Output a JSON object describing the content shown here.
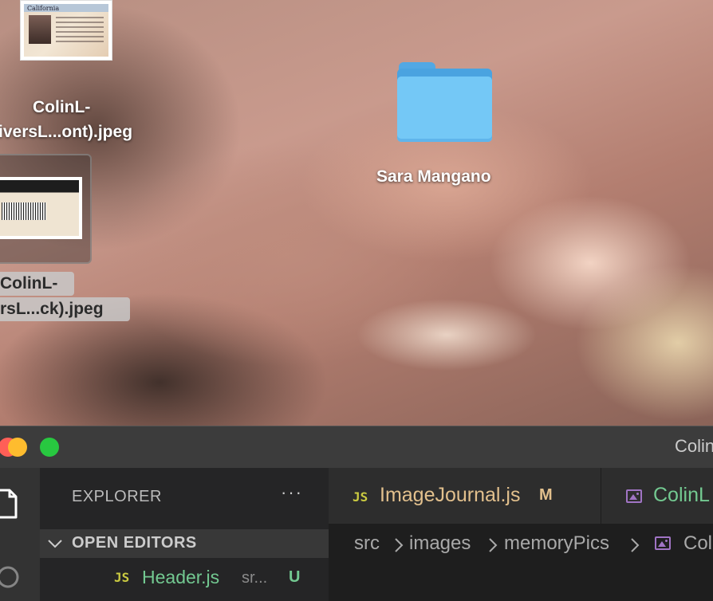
{
  "desktop": {
    "items": [
      {
        "label": "ColinL-\niversL...ont).jpeg",
        "line1": "ColinL-",
        "line2": "iversL...ont).jpeg"
      },
      {
        "label": "ColinL-\nrsL...ck).jpeg",
        "line1": "ColinL-",
        "line2": "rsL...ck).jpeg",
        "selected": true
      },
      {
        "label": "Sara Mangano"
      }
    ],
    "card_front_title": "California"
  },
  "window": {
    "title": "Colin",
    "traffic": {
      "close": "#ff5f57",
      "minimize": "#febc2e",
      "zoom": "#28c840"
    }
  },
  "sidebar": {
    "header": "EXPLORER",
    "more": "···",
    "open_editors": "OPEN EDITORS",
    "files": [
      {
        "badge": "JS",
        "name": "Header.js",
        "desc": "sr...",
        "status": "U"
      }
    ]
  },
  "tabs": [
    {
      "badge": "JS",
      "name": "ImageJournal.js",
      "status": "M"
    },
    {
      "icon": "image-icon",
      "name": "ColinL"
    }
  ],
  "breadcrumbs": [
    "src",
    "images",
    "memoryPics",
    "Col"
  ],
  "colors": {
    "modified": "#e2c08d",
    "untracked": "#73c991",
    "js": "#cbcb41",
    "image_icon": "#a074c4"
  }
}
